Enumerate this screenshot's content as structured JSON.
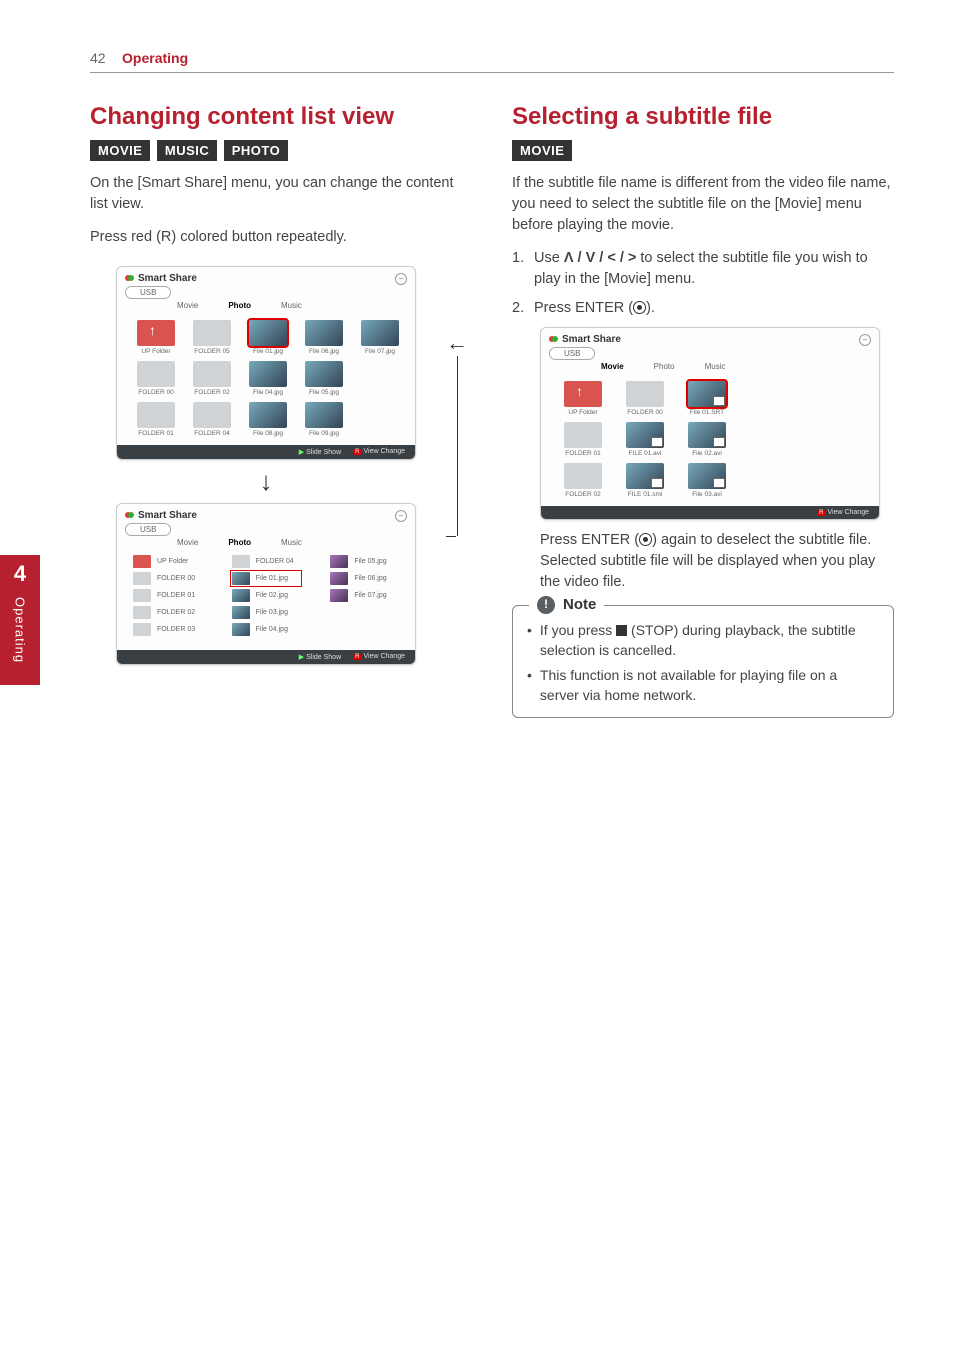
{
  "header": {
    "page_number": "42",
    "section": "Operating"
  },
  "side_tab": {
    "number": "4",
    "label": "Operating"
  },
  "left": {
    "title": "Changing content list view",
    "tags": [
      "MOVIE",
      "MUSIC",
      "PHOTO"
    ],
    "para1": "On the [Smart Share] menu, you can change the content list view.",
    "para2": "Press red (R) colored button repeatedly.",
    "mock_a": {
      "app": "Smart Share",
      "source": "USB",
      "tabs": {
        "movie": "Movie",
        "photo": "Photo",
        "music": "Music",
        "active": "Photo"
      },
      "items": [
        {
          "label": "UP Folder",
          "kind": "up"
        },
        {
          "label": "FOLDER 05",
          "kind": "f"
        },
        {
          "label": "File 01.jpg",
          "kind": "img",
          "sel": true
        },
        {
          "label": "File 06.jpg",
          "kind": "img"
        },
        {
          "label": "File 07.jpg",
          "kind": "img"
        },
        {
          "label": "FOLDER 00",
          "kind": "f"
        },
        {
          "label": "FOLDER 02",
          "kind": "f"
        },
        {
          "label": "File 04.jpg",
          "kind": "img"
        },
        {
          "label": "File 05.jpg",
          "kind": "img"
        },
        {
          "label": "",
          "kind": "blank"
        },
        {
          "label": "FOLDER 01",
          "kind": "f"
        },
        {
          "label": "FOLDER 04",
          "kind": "f"
        },
        {
          "label": "File 08.jpg",
          "kind": "img"
        },
        {
          "label": "File 09.jpg",
          "kind": "img"
        }
      ],
      "footer": {
        "play": "Slide Show",
        "red": "View Change"
      }
    },
    "mock_b": {
      "app": "Smart Share",
      "source": "USB",
      "tabs": {
        "movie": "Movie",
        "photo": "Photo",
        "music": "Music",
        "active": "Photo"
      },
      "col1": [
        {
          "label": "UP Folder",
          "kind": "up"
        },
        {
          "label": "FOLDER 00",
          "kind": "f"
        },
        {
          "label": "FOLDER 01",
          "kind": "f"
        },
        {
          "label": "FOLDER 02",
          "kind": "f"
        },
        {
          "label": "FOLDER 03",
          "kind": "f"
        }
      ],
      "col2": [
        {
          "label": "FOLDER 04",
          "kind": "f"
        },
        {
          "label": "File 01.jpg",
          "kind": "img",
          "sel": true
        },
        {
          "label": "File 02.jpg",
          "kind": "img"
        },
        {
          "label": "File 03.jpg",
          "kind": "img"
        },
        {
          "label": "File 04.jpg",
          "kind": "img"
        }
      ],
      "col3": [
        {
          "label": "File 05.jpg",
          "kind": "img2"
        },
        {
          "label": "File 06.jpg",
          "kind": "img2"
        },
        {
          "label": "File 07.jpg",
          "kind": "img2"
        }
      ],
      "footer": {
        "play": "Slide Show",
        "red": "View Change"
      }
    }
  },
  "right": {
    "title": "Selecting a subtitle file",
    "tags": [
      "MOVIE"
    ],
    "para1": "If the subtitle file name is different from the video file name, you need to select the subtitle file on the [Movie] menu before playing the movie.",
    "step1_pre": "Use ",
    "step1_keys": "W/S/A/D",
    "step1_post": " to select the subtitle file you wish to play in the [Movie] menu.",
    "step2_pre": "Press ENTER (",
    "step2_post": ").",
    "mock": {
      "app": "Smart Share",
      "source": "USB",
      "tabs": {
        "movie": "Movie",
        "photo": "Photo",
        "music": "Music",
        "active": "Movie"
      },
      "items": [
        {
          "label": "UP Folder",
          "kind": "up"
        },
        {
          "label": "FOLDER 00",
          "kind": "f"
        },
        {
          "label": "File 01.SRT",
          "kind": "subt",
          "sel": true
        },
        {
          "label": "FOLDER 01",
          "kind": "f"
        },
        {
          "label": "FILE 01.avi",
          "kind": "subt"
        },
        {
          "label": "File 02.avi",
          "kind": "subt"
        },
        {
          "label": "FOLDER 02",
          "kind": "f"
        },
        {
          "label": "FILE 01.smi",
          "kind": "subt"
        },
        {
          "label": "File 03.avi",
          "kind": "subt"
        }
      ],
      "footer": {
        "red": "View Change"
      }
    },
    "after_mock": "Press ENTER (b) again to deselect the subtitle file. Selected subtitle file will be displayed when you play the video file.",
    "note_label": "Note",
    "note1_pre": "If you press ",
    "note1_mid": " (STOP) during playback, the subtitle selection is cancelled.",
    "note2": "This function is not available for playing file on a server via home network."
  }
}
